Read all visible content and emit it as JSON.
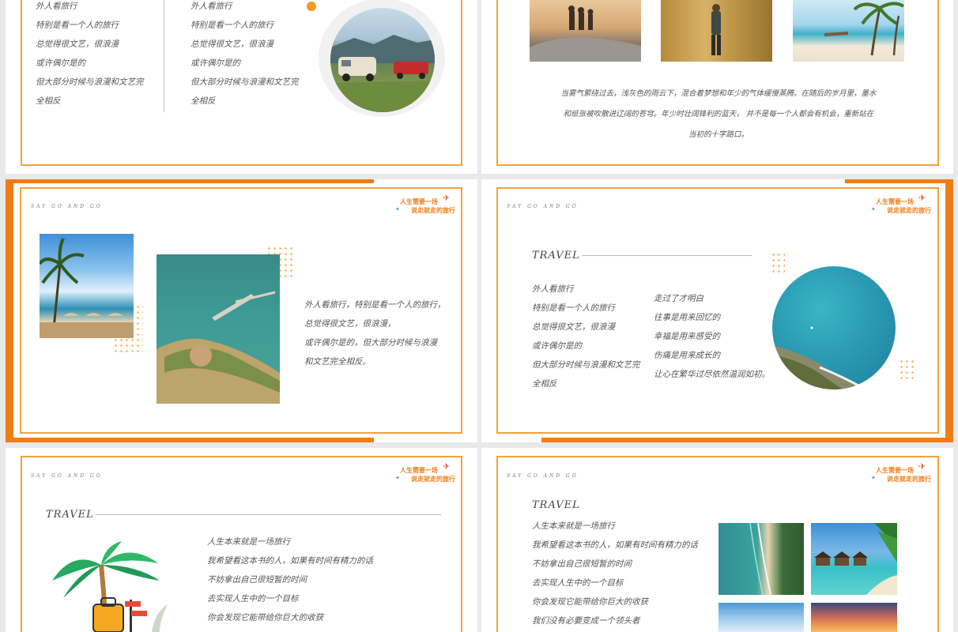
{
  "brand": {
    "tag": "SAY GO AND GO",
    "logo_line1": "人生需要一场",
    "logo_line2": "说走就走的旅行"
  },
  "colors": {
    "accent": "#ef7d16",
    "frame": "#f2a23c"
  },
  "slide1": {
    "col1": [
      "外人看旅行",
      "特别是看一个人的旅行",
      "总觉得很文艺，很浪漫",
      "或许偶尔是的",
      "但大部分时候与浪漫和文艺完",
      "全相反"
    ],
    "col2": [
      "外人看旅行",
      "特别是看一个人的旅行",
      "总觉得很文艺，很浪漫",
      "或许偶尔是的",
      "但大部分时候与浪漫和文艺完",
      "全相反"
    ]
  },
  "slide2": {
    "para_lines": [
      "当雾气萦绕过去，浅灰色的雨云下，混合着梦想和年少的气体缓慢蒸腾。在随后的岁月里，墨水",
      "和纸张被吹散进辽阔的苍穹。年少时壮阔锋利的蓝天，  并不是每一个人都会有机会，重新站在",
      "当初的十字路口。"
    ]
  },
  "slide3": {
    "lines": [
      "外人看旅行，特别是看一个人的旅行，",
      "总觉得很文艺，很浪漫，",
      "或许偶尔是的，但大部分时候与浪漫",
      "和文艺完全相反。"
    ]
  },
  "slide4": {
    "title": "TRAVEL",
    "col1": [
      "外人看旅行",
      "特别是看一个人的旅行",
      "总觉得很文艺，很浪漫",
      "或许偶尔是的",
      "但大部分时候与浪漫和文艺完",
      "全相反"
    ],
    "col2": [
      "走过了才明白",
      "往事是用来回忆的",
      "幸福是用来感受的",
      "伤痛是用来成长的",
      "让心在繁华过尽依然温润如初。"
    ]
  },
  "slide5": {
    "title": "TRAVEL",
    "lines": [
      "人生本来就是一场旅行",
      "我希望看这本书的人，如果有时间有精力的话",
      "不妨拿出自己很短暂的时间",
      "去实现人生中的一个目标",
      "你会发现它能带给你巨大的收获"
    ]
  },
  "slide6": {
    "title": "TRAVEL",
    "lines": [
      "人生本来就是一场旅行",
      "我希望看这本书的人，如果有时间有精力的话",
      "不妨拿出自己很短暂的时间",
      "去实现人生中的一个目标",
      "你会发现它能带给你巨大的收获",
      "我们没有必要变成一个领头者"
    ]
  }
}
